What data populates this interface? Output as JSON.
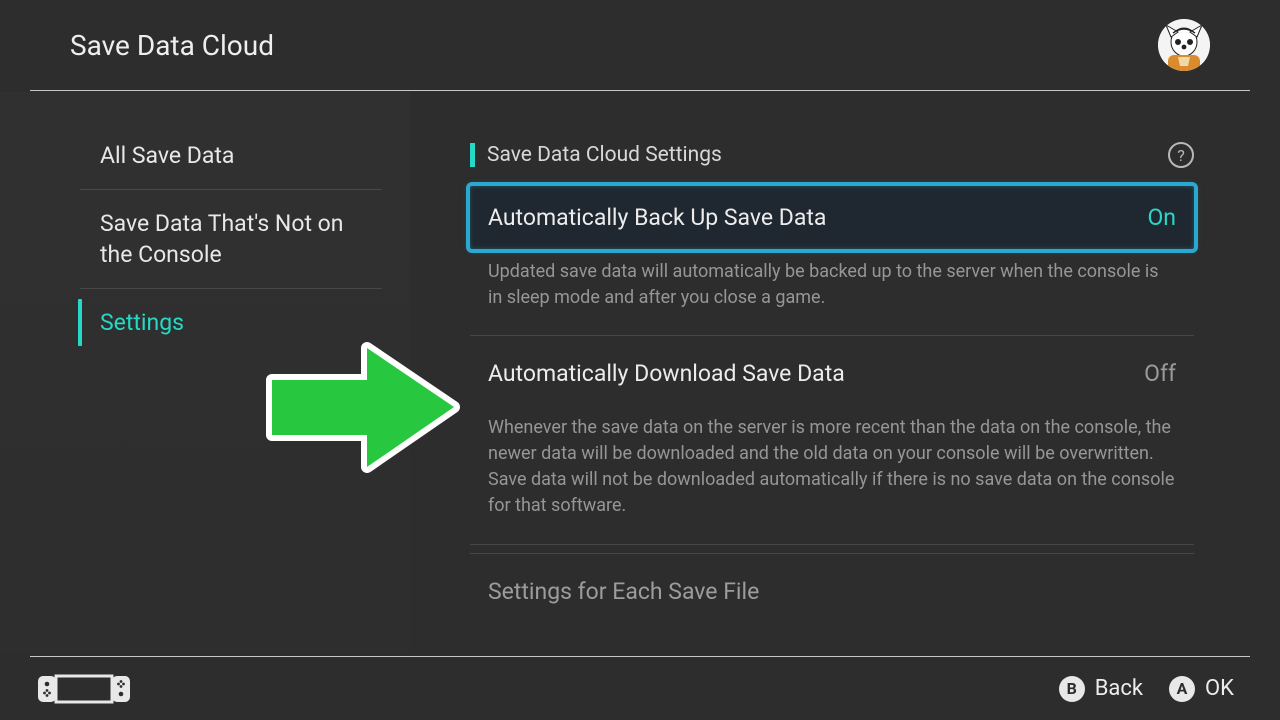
{
  "header": {
    "title": "Save Data Cloud"
  },
  "sidebar": {
    "items": [
      {
        "label": "All Save Data",
        "active": false
      },
      {
        "label": "Save Data That's Not on the Console",
        "active": false
      },
      {
        "label": "Settings",
        "active": true
      }
    ]
  },
  "main": {
    "section_title": "Save Data Cloud Settings",
    "help": "?",
    "options": [
      {
        "label": "Automatically Back Up Save Data",
        "value": "On",
        "state": "on",
        "selected": true,
        "description": "Updated save data will automatically be backed up to the server when the console is in sleep mode and after you close a game."
      },
      {
        "label": "Automatically Download Save Data",
        "value": "Off",
        "state": "off",
        "selected": false,
        "description": "Whenever the save data on the server is more recent than the data on the console, the newer data will be downloaded and the old data on your console will be overwritten. Save data will not be downloaded automatically if there is no save data on the console for that software."
      }
    ],
    "section_row": "Settings for Each Save File"
  },
  "footer": {
    "back": {
      "letter": "B",
      "label": "Back"
    },
    "ok": {
      "letter": "A",
      "label": "OK"
    }
  },
  "colors": {
    "accent": "#26d9c7",
    "highlight": "#2aa8d0",
    "arrow": "#27c840"
  }
}
